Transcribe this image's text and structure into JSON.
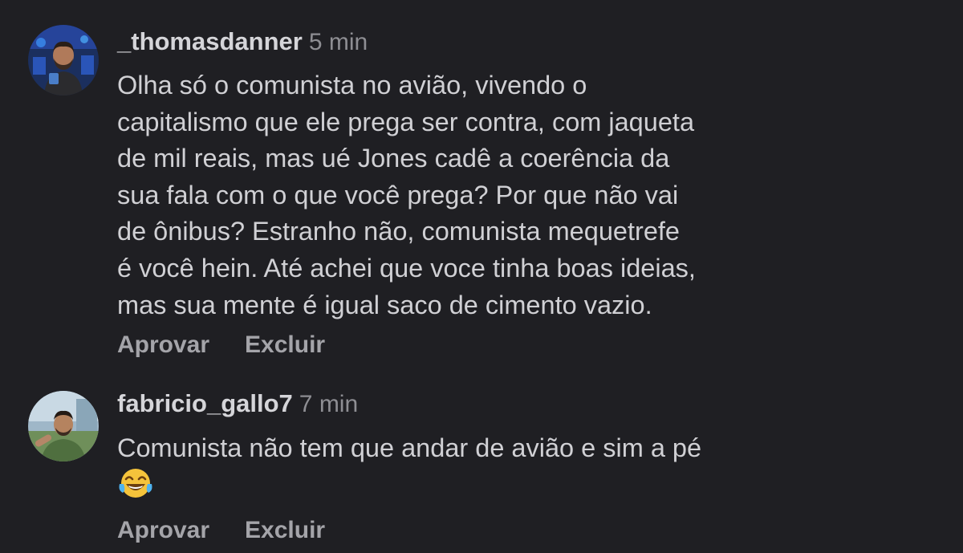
{
  "comments": [
    {
      "username": "_thomasdanner",
      "time": "5 min",
      "text": "Olha só o comunista no avião, vivendo o\ncapitalismo que ele prega ser contra, com jaqueta\nde mil reais, mas ué Jones cadê a coerência da\nsua fala com o que você prega? Por que não vai\nde ônibus? Estranho não, comunista mequetrefe\né você hein. Até achei que voce tinha boas ideias,\nmas sua mente é igual saco de cimento vazio.",
      "approve_label": "Aprovar",
      "delete_label": "Excluir"
    },
    {
      "username": "fabricio_gallo7",
      "time": "7 min",
      "text": "Comunista não tem que andar de avião e sim a pé",
      "emoji": "laughing-tears-emoji",
      "approve_label": "Aprovar",
      "delete_label": "Excluir"
    }
  ],
  "colors": {
    "background": "#1f1f23",
    "username": "#d5d5d9",
    "timestamp": "#8e8e93",
    "action": "#a4a4a9"
  }
}
